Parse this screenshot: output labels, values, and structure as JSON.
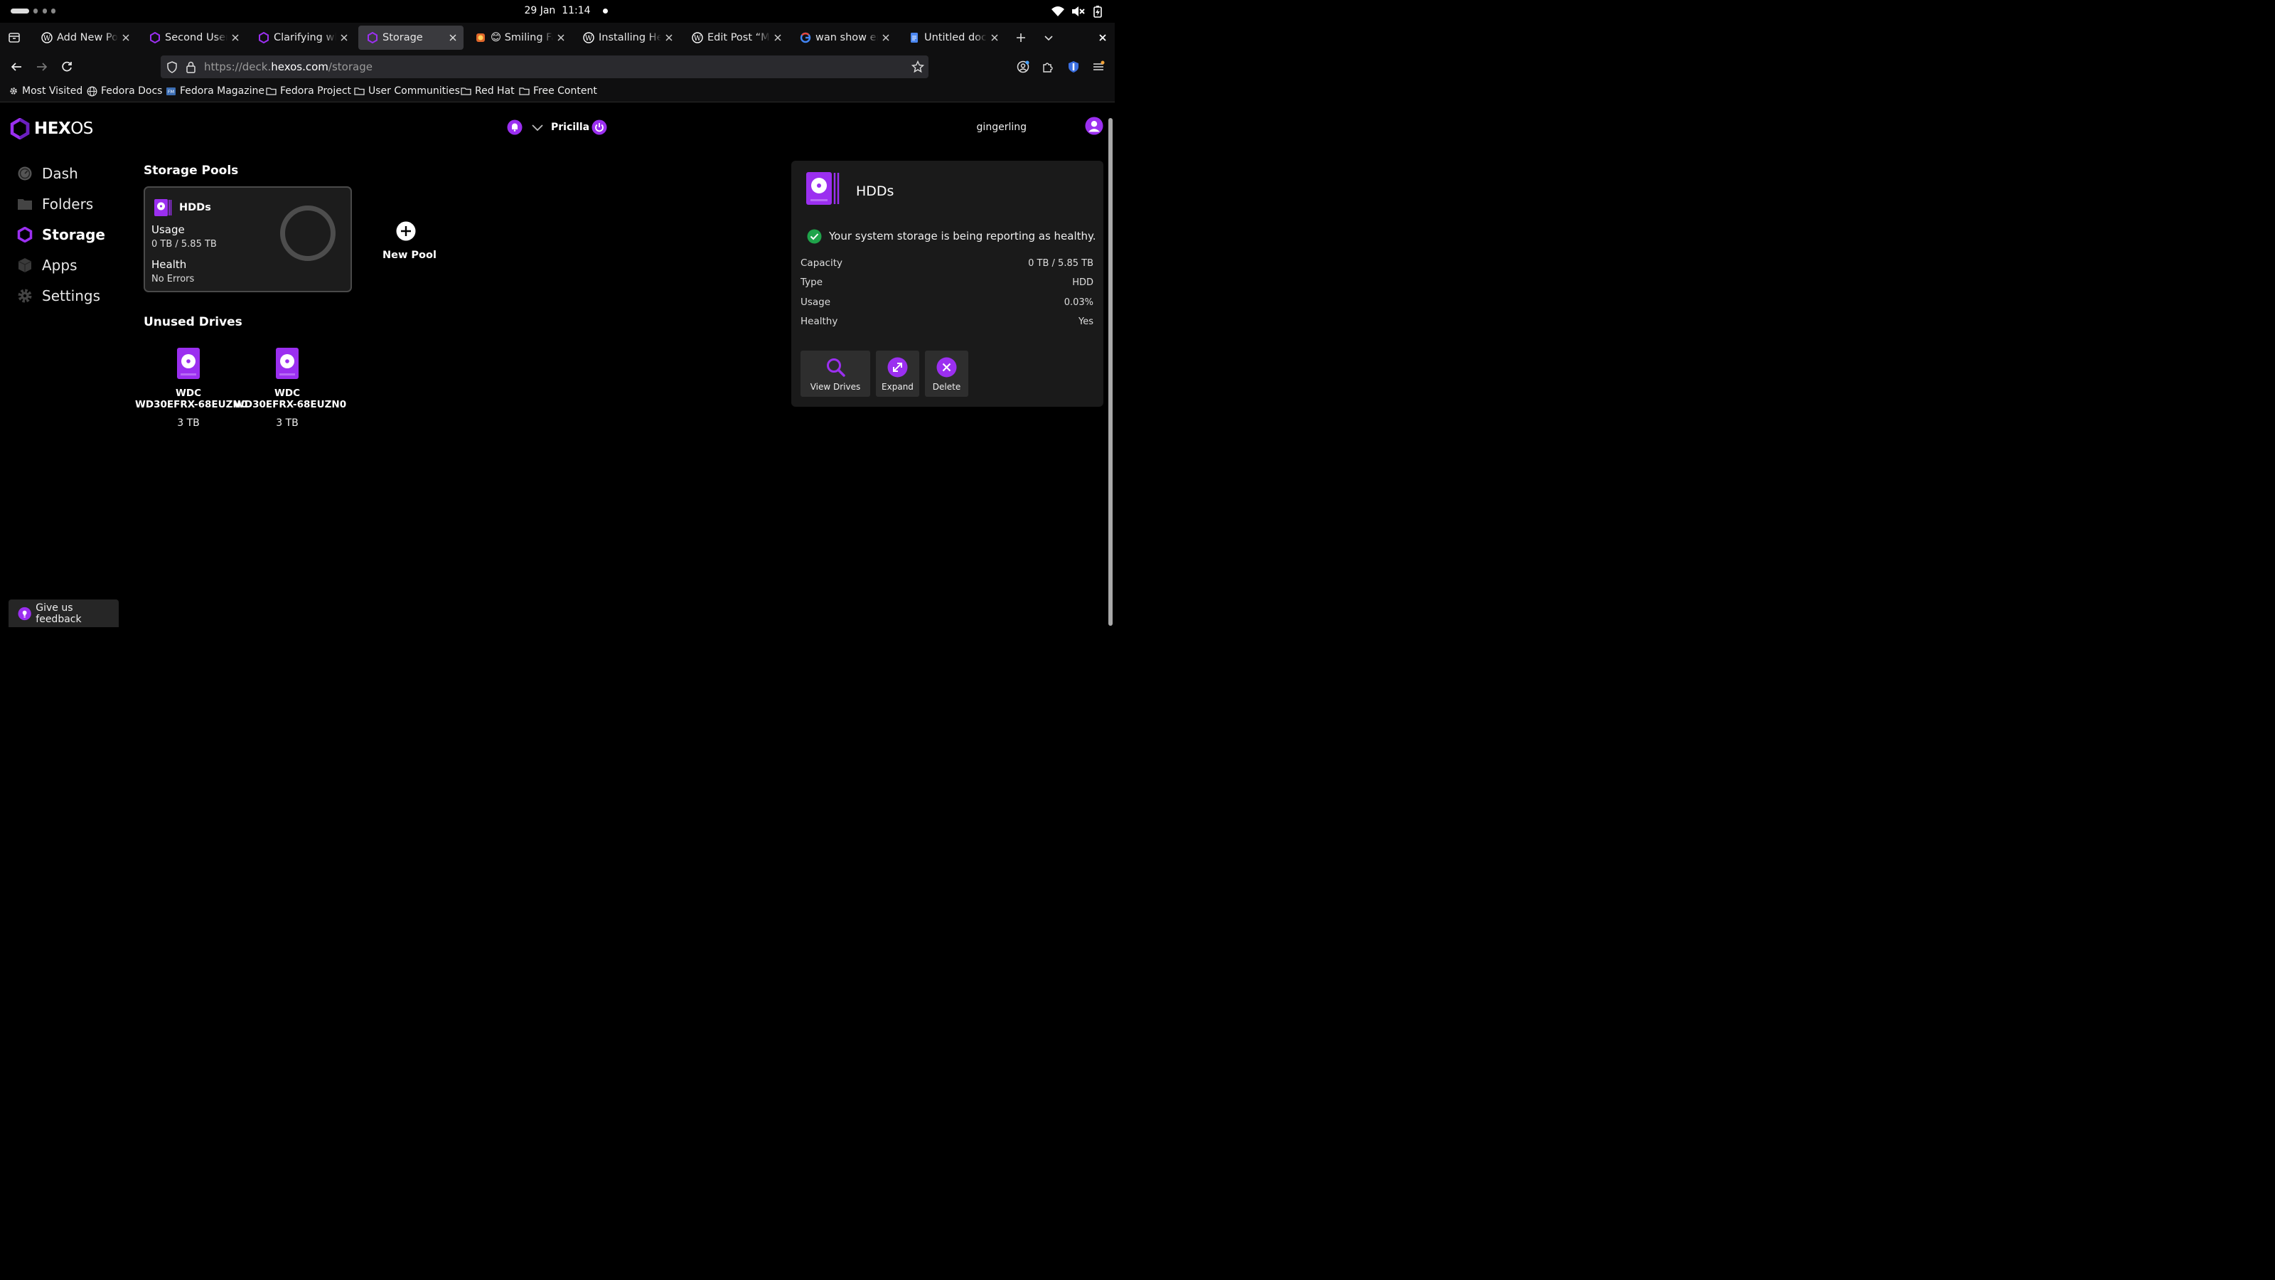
{
  "system": {
    "date": "29 Jan",
    "time": "11:14"
  },
  "browser": {
    "tabs": [
      {
        "label": "Add New Post",
        "icon": "wordpress-icon",
        "active": false
      },
      {
        "label": "Second User/P",
        "icon": "hexos-icon",
        "active": false
      },
      {
        "label": "Clarifying who",
        "icon": "hexos-icon",
        "active": false
      },
      {
        "label": "Storage",
        "icon": "hexos-icon",
        "active": true
      },
      {
        "label": "😊 Smiling Fac",
        "icon": "emoji-site-icon",
        "active": false
      },
      {
        "label": "Installing Hex",
        "icon": "wordpress-icon",
        "active": false
      },
      {
        "label": "Edit Post “Mal",
        "icon": "wordpress-icon",
        "active": false
      },
      {
        "label": "wan show em",
        "icon": "google-icon",
        "active": false
      },
      {
        "label": "Untitled docu",
        "icon": "google-docs-icon",
        "active": false
      }
    ],
    "url_prefix": "https://deck.",
    "url_domain": "hexos.com",
    "url_path": "/storage",
    "bookmarks": [
      {
        "label": "Most Visited",
        "icon": "gear-icon"
      },
      {
        "label": "Fedora Docs",
        "icon": "globe-icon"
      },
      {
        "label": "Fedora Magazine",
        "icon": "fedora-magazine-icon"
      },
      {
        "label": "Fedora Project",
        "icon": "folder-icon"
      },
      {
        "label": "User Communities",
        "icon": "folder-icon"
      },
      {
        "label": "Red Hat",
        "icon": "folder-icon"
      },
      {
        "label": "Free Content",
        "icon": "folder-icon"
      }
    ]
  },
  "app": {
    "logo_hex": "HEX",
    "logo_os": "OS",
    "server_name": "Pricilla",
    "username": "gingerling",
    "nav": [
      {
        "label": "Dash",
        "icon": "gauge-icon",
        "active": false
      },
      {
        "label": "Folders",
        "icon": "folder-icon",
        "active": false
      },
      {
        "label": "Storage",
        "icon": "hexagon-icon",
        "active": true
      },
      {
        "label": "Apps",
        "icon": "cube-icon",
        "active": false
      },
      {
        "label": "Settings",
        "icon": "gear-icon",
        "active": false
      }
    ],
    "storage_pools_title": "Storage Pools",
    "pool": {
      "name": "HDDs",
      "usage_label": "Usage",
      "usage_value": "0 TB / 5.85 TB",
      "usage_fraction": 0.0003,
      "health_label": "Health",
      "health_value": "No Errors"
    },
    "new_pool_label": "New Pool",
    "unused_drives_title": "Unused Drives",
    "unused_drives": [
      {
        "brand": "WDC",
        "model": "WD30EFRX-68EUZN0",
        "size": "3 TB"
      },
      {
        "brand": "WDC",
        "model": "WD30EFRX-68EUZN0",
        "size": "3 TB"
      }
    ],
    "detail": {
      "title": "HDDs",
      "status_message": "Your system storage is being reporting as healthy.",
      "properties": [
        {
          "label": "Capacity",
          "value": "0 TB / 5.85 TB"
        },
        {
          "label": "Type",
          "value": "HDD"
        },
        {
          "label": "Usage",
          "value": "0.03%"
        },
        {
          "label": "Healthy",
          "value": "Yes"
        }
      ],
      "actions": [
        {
          "label": "View Drives",
          "icon": "search-icon"
        },
        {
          "label": "Expand",
          "icon": "expand-icon"
        },
        {
          "label": "Delete",
          "icon": "close-circle-icon"
        }
      ]
    },
    "feedback_label": "Give us feedback",
    "colors": {
      "accent": "#9b2ff0",
      "healthy": "#1fa34a",
      "card": "#1c1c1c",
      "panel": "#1a1a1a"
    }
  }
}
